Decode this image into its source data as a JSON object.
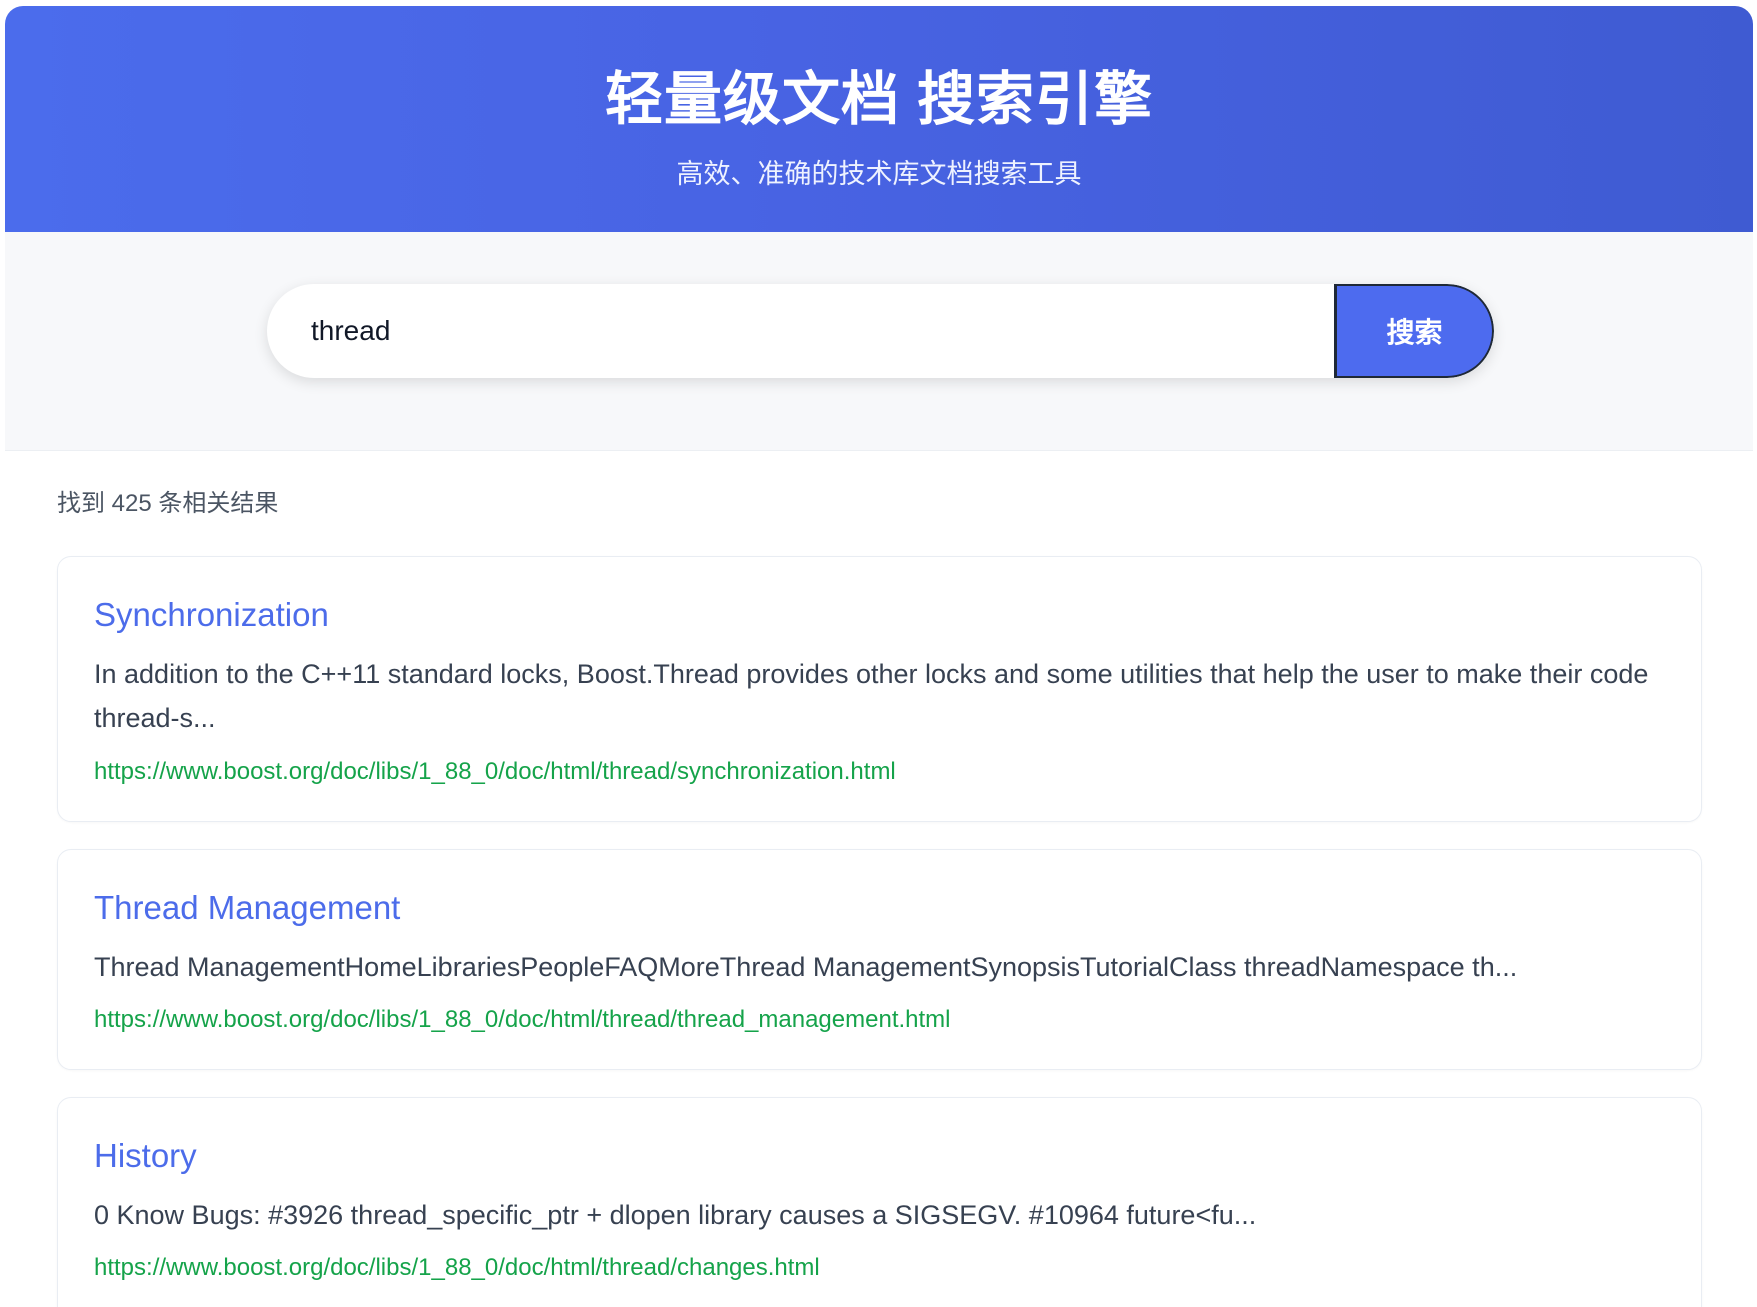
{
  "header": {
    "title": "轻量级文档 搜索引擎",
    "subtitle": "高效、准确的技术库文档搜索工具"
  },
  "search": {
    "query": "thread",
    "button_label": "搜索"
  },
  "results": {
    "count_text": "找到 425 条相关结果",
    "items": [
      {
        "title": "Synchronization",
        "snippet": "In addition to the C++11 standard locks, Boost.Thread provides other locks and some utilities that help the user to make their code thread-s...",
        "url": "https://www.boost.org/doc/libs/1_88_0/doc/html/thread/synchronization.html"
      },
      {
        "title": "Thread Management",
        "snippet": "Thread ManagementHomeLibrariesPeopleFAQMoreThread ManagementSynopsisTutorialClass threadNamespace th...",
        "url": "https://www.boost.org/doc/libs/1_88_0/doc/html/thread/thread_management.html"
      },
      {
        "title": "History",
        "snippet": "0 Know Bugs: #3926 thread_specific_ptr + dlopen library causes a SIGSEGV. #10964 future<fu...",
        "url": "https://www.boost.org/doc/libs/1_88_0/doc/html/thread/changes.html"
      }
    ]
  },
  "colors": {
    "header_gradient_start": "#4b6cec",
    "header_gradient_end": "#3f5bd2",
    "accent": "#4c6cea",
    "url": "#15a34a",
    "text": "#374151"
  }
}
